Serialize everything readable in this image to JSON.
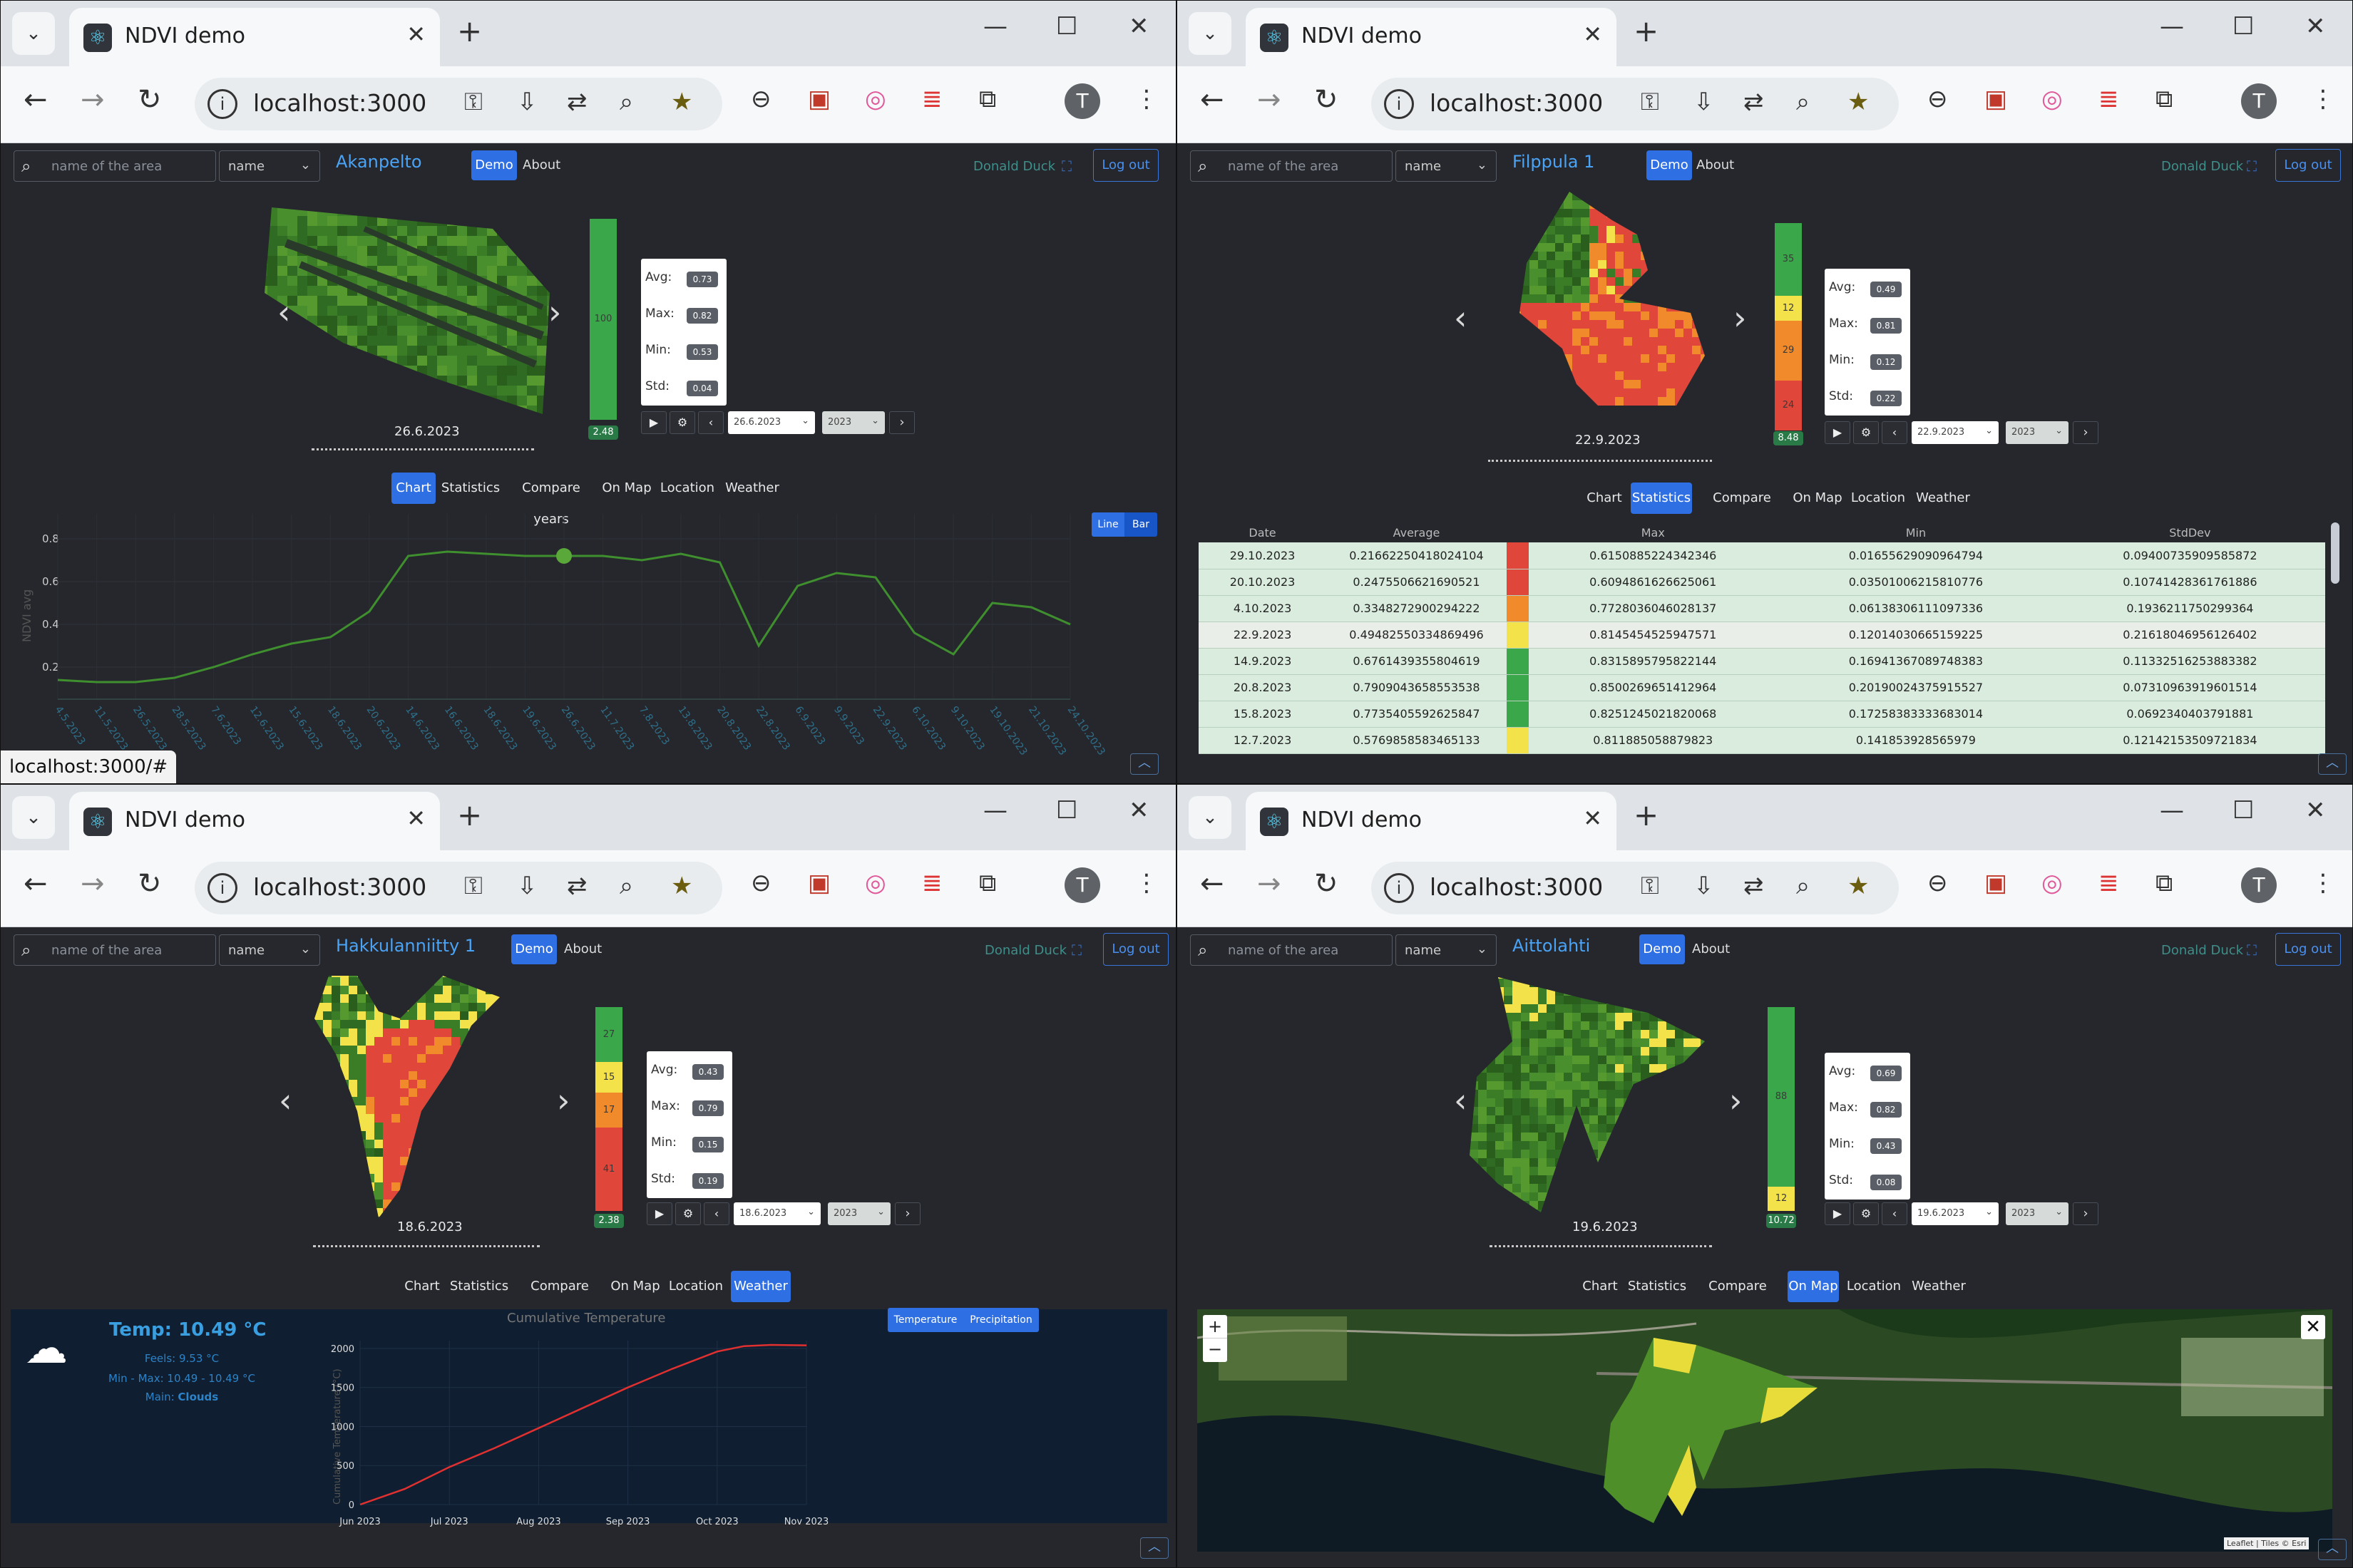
{
  "browser": {
    "tab_title": "NDVI demo",
    "url": "localhost:3000",
    "status_url": "localhost:3000/#",
    "avatar_letter": "T"
  },
  "app": {
    "search_placeholder": "name of the area",
    "search_mode": "name",
    "demo_label": "Demo",
    "about_label": "About",
    "user_name": "Donald Duck",
    "logout_label": "Log out",
    "tabs": [
      "Chart",
      "Statistics",
      "Compare years",
      "On Map",
      "Location",
      "Weather"
    ]
  },
  "windows": [
    {
      "area_name": "Akanpelto",
      "date_caption": "26.6.2023",
      "date_select": "26.6.2023",
      "year_select": "2023",
      "legend": [
        {
          "label": "100",
          "color": "#3aa84a"
        }
      ],
      "legend_badge": "2.48",
      "stats": {
        "avg": "0.73",
        "max": "0.82",
        "min": "0.53",
        "std": "0.04"
      },
      "active_tab": "Chart",
      "chart_toggle": [
        "Line",
        "Bar"
      ],
      "chart_data": {
        "type": "line",
        "ylabel": "NDVI avg",
        "ylim": [
          0.05,
          0.85
        ],
        "y_ticks": [
          "0.8",
          "0.6",
          "0.4",
          "0.2"
        ],
        "categories": [
          "4.5.2023",
          "11.5.2023",
          "26.5.2023",
          "28.5.2023",
          "7.6.2023",
          "12.6.2023",
          "15.6.2023",
          "18.6.2023",
          "20.6.2023",
          "14.6.2023",
          "16.6.2023",
          "18.6.2023",
          "19.6.2023",
          "26.6.2023",
          "11.7.2023",
          "7.8.2023",
          "13.8.2023",
          "20.8.2023",
          "22.8.2023",
          "6.9.2023",
          "9.9.2023",
          "22.9.2023",
          "6.10.2023",
          "9.10.2023",
          "19.10.2023",
          "21.10.2023",
          "24.10.2023"
        ],
        "values": [
          0.14,
          0.13,
          0.13,
          0.15,
          0.2,
          0.26,
          0.31,
          0.34,
          0.46,
          0.72,
          0.74,
          0.73,
          0.72,
          0.72,
          0.72,
          0.7,
          0.73,
          0.69,
          0.3,
          0.58,
          0.64,
          0.62,
          0.36,
          0.26,
          0.5,
          0.48,
          0.4
        ],
        "highlight_index": 13
      }
    },
    {
      "area_name": "Filppula 1",
      "date_caption": "22.9.2023",
      "date_select": "22.9.2023",
      "year_select": "2023",
      "legend": [
        {
          "label": "35",
          "color": "#3aa84a"
        },
        {
          "label": "12",
          "color": "#f3e24a"
        },
        {
          "label": "29",
          "color": "#f08a2a"
        },
        {
          "label": "24",
          "color": "#e0473a"
        }
      ],
      "legend_badge": "8.48",
      "stats": {
        "avg": "0.49",
        "max": "0.81",
        "min": "0.12",
        "std": "0.22"
      },
      "active_tab": "Statistics",
      "table": {
        "headers": [
          "Date",
          "Average",
          "Max",
          "Min",
          "StdDev"
        ],
        "rows": [
          {
            "date": "29.10.2023",
            "avg": "0.21662250418024104",
            "color": "#e0473a",
            "max": "0.6150885224342346",
            "min": "0.01655629090964794",
            "std": "0.09400735909585872"
          },
          {
            "date": "20.10.2023",
            "avg": "0.2475506621690521",
            "color": "#e0473a",
            "max": "0.6094861626625061",
            "min": "0.03501006215810776",
            "std": "0.10741428361761886"
          },
          {
            "date": "4.10.2023",
            "avg": "0.3348272900294222",
            "color": "#f08a2a",
            "max": "0.7728036046028137",
            "min": "0.06138306111097336",
            "std": "0.1936211750299364"
          },
          {
            "date": "22.9.2023",
            "avg": "0.49482550334869496",
            "color": "#f3e24a",
            "max": "0.8145454525947571",
            "min": "0.12014030665159225",
            "std": "0.21618046956126402"
          },
          {
            "date": "14.9.2023",
            "avg": "0.6761439355804619",
            "color": "#3aa84a",
            "max": "0.8315895795822144",
            "min": "0.16941367089748383",
            "std": "0.11332516253883382"
          },
          {
            "date": "20.8.2023",
            "avg": "0.7909043658553538",
            "color": "#3aa84a",
            "max": "0.8500269651412964",
            "min": "0.20190024375915527",
            "std": "0.07310963919601514"
          },
          {
            "date": "15.8.2023",
            "avg": "0.7735405592625847",
            "color": "#3aa84a",
            "max": "0.8251245021820068",
            "min": "0.17258383333683014",
            "std": "0.0692340403791881"
          },
          {
            "date": "12.7.2023",
            "avg": "0.5769858583465133",
            "color": "#f3e24a",
            "max": "0.811885058879823",
            "min": "0.141853928565979",
            "std": "0.12142153509721834"
          }
        ],
        "selected_index": 3
      }
    },
    {
      "area_name": "Hakkulanniitty 1",
      "date_caption": "18.6.2023",
      "date_select": "18.6.2023",
      "year_select": "2023",
      "legend": [
        {
          "label": "27",
          "color": "#3aa84a"
        },
        {
          "label": "15",
          "color": "#f3e24a"
        },
        {
          "label": "17",
          "color": "#f08a2a"
        },
        {
          "label": "41",
          "color": "#e0473a"
        }
      ],
      "legend_badge": "2.38",
      "stats": {
        "avg": "0.43",
        "max": "0.79",
        "min": "0.15",
        "std": "0.19"
      },
      "active_tab": "Weather",
      "weather": {
        "temp": "Temp: 10.49 °C",
        "feels": "Feels: 9.53 °C",
        "minmax": "Min - Max: 10.49 - 10.49 °C",
        "main_label": "Main:",
        "main_value": "Clouds",
        "toggle": [
          "Temperature",
          "Precipitation"
        ]
      },
      "chart_data": {
        "type": "line",
        "title": "Cumulative Temperature",
        "ylabel": "Cumulative Temperature (°C)",
        "ylim": [
          0,
          2100
        ],
        "y_ticks": [
          "2000",
          "1500",
          "1000",
          "500",
          "0"
        ],
        "x_ticks": [
          "Jun 2023",
          "Jul 2023",
          "Aug 2023",
          "Sep 2023",
          "Oct 2023",
          "Nov 2023"
        ],
        "x": [
          0,
          0.5,
          1,
          1.5,
          2,
          2.5,
          3,
          3.5,
          4,
          4.3,
          4.6,
          5
        ],
        "values": [
          0,
          200,
          480,
          720,
          980,
          1240,
          1500,
          1740,
          1960,
          2030,
          2045,
          2040
        ],
        "color": "#e03030"
      }
    },
    {
      "area_name": "Aittolahti",
      "date_caption": "19.6.2023",
      "date_select": "19.6.2023",
      "year_select": "2023",
      "legend": [
        {
          "label": "88",
          "color": "#3aa84a"
        },
        {
          "label": "12",
          "color": "#f3e24a"
        }
      ],
      "legend_badge": "10.72",
      "stats": {
        "avg": "0.69",
        "max": "0.82",
        "min": "0.43",
        "std": "0.08"
      },
      "active_tab": "On Map",
      "map": {
        "zoom_in": "+",
        "zoom_out": "−",
        "close": "✕",
        "attribution": "Leaflet | Tiles © Esri"
      }
    }
  ]
}
